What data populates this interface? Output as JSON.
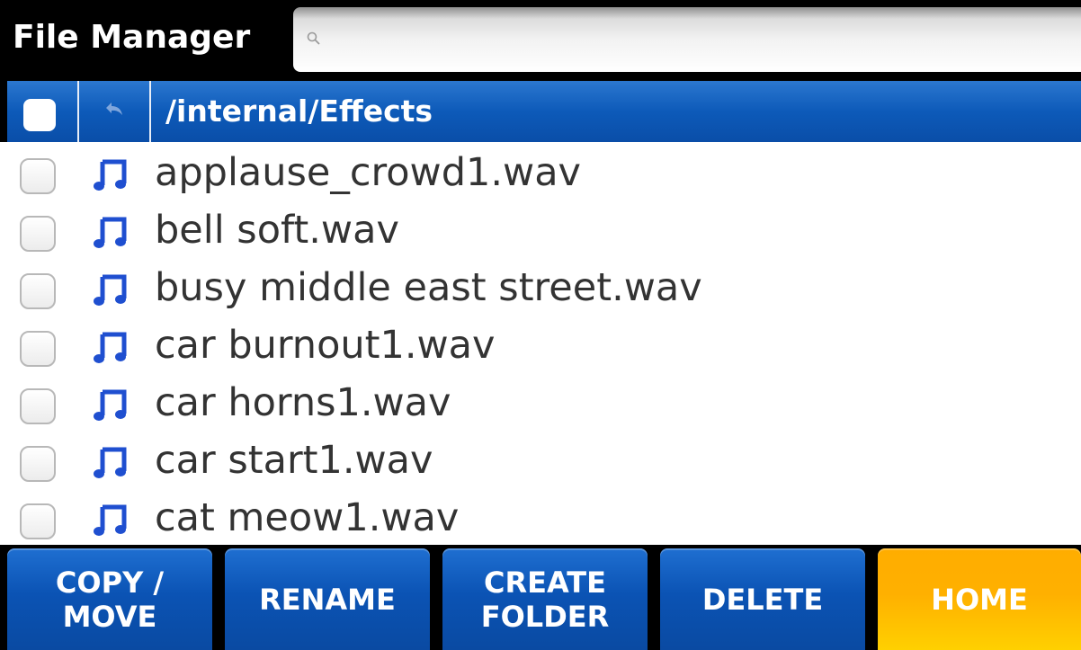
{
  "app": {
    "title": "File Manager"
  },
  "search": {
    "placeholder": "",
    "value": ""
  },
  "pathbar": {
    "path": "/internal/Effects"
  },
  "files": [
    {
      "name": "applause_crowd1.wav"
    },
    {
      "name": "bell soft.wav"
    },
    {
      "name": "busy middle east street.wav"
    },
    {
      "name": "car burnout1.wav"
    },
    {
      "name": "car horns1.wav"
    },
    {
      "name": "car start1.wav"
    },
    {
      "name": "cat meow1.wav"
    }
  ],
  "toolbar": {
    "copy_move_line1": "COPY /",
    "copy_move_line2": "MOVE",
    "rename": "RENAME",
    "create_folder_line1": "CREATE",
    "create_folder_line2": "FOLDER",
    "delete": "DELETE",
    "home": "HOME"
  },
  "colors": {
    "accent_blue": "#0d5ab9",
    "home_orange": "#ffb000",
    "file_icon_blue": "#1f4fd0"
  },
  "icons": {
    "search": "search-icon",
    "up": "up-folder-icon",
    "file": "music-note-icon"
  }
}
